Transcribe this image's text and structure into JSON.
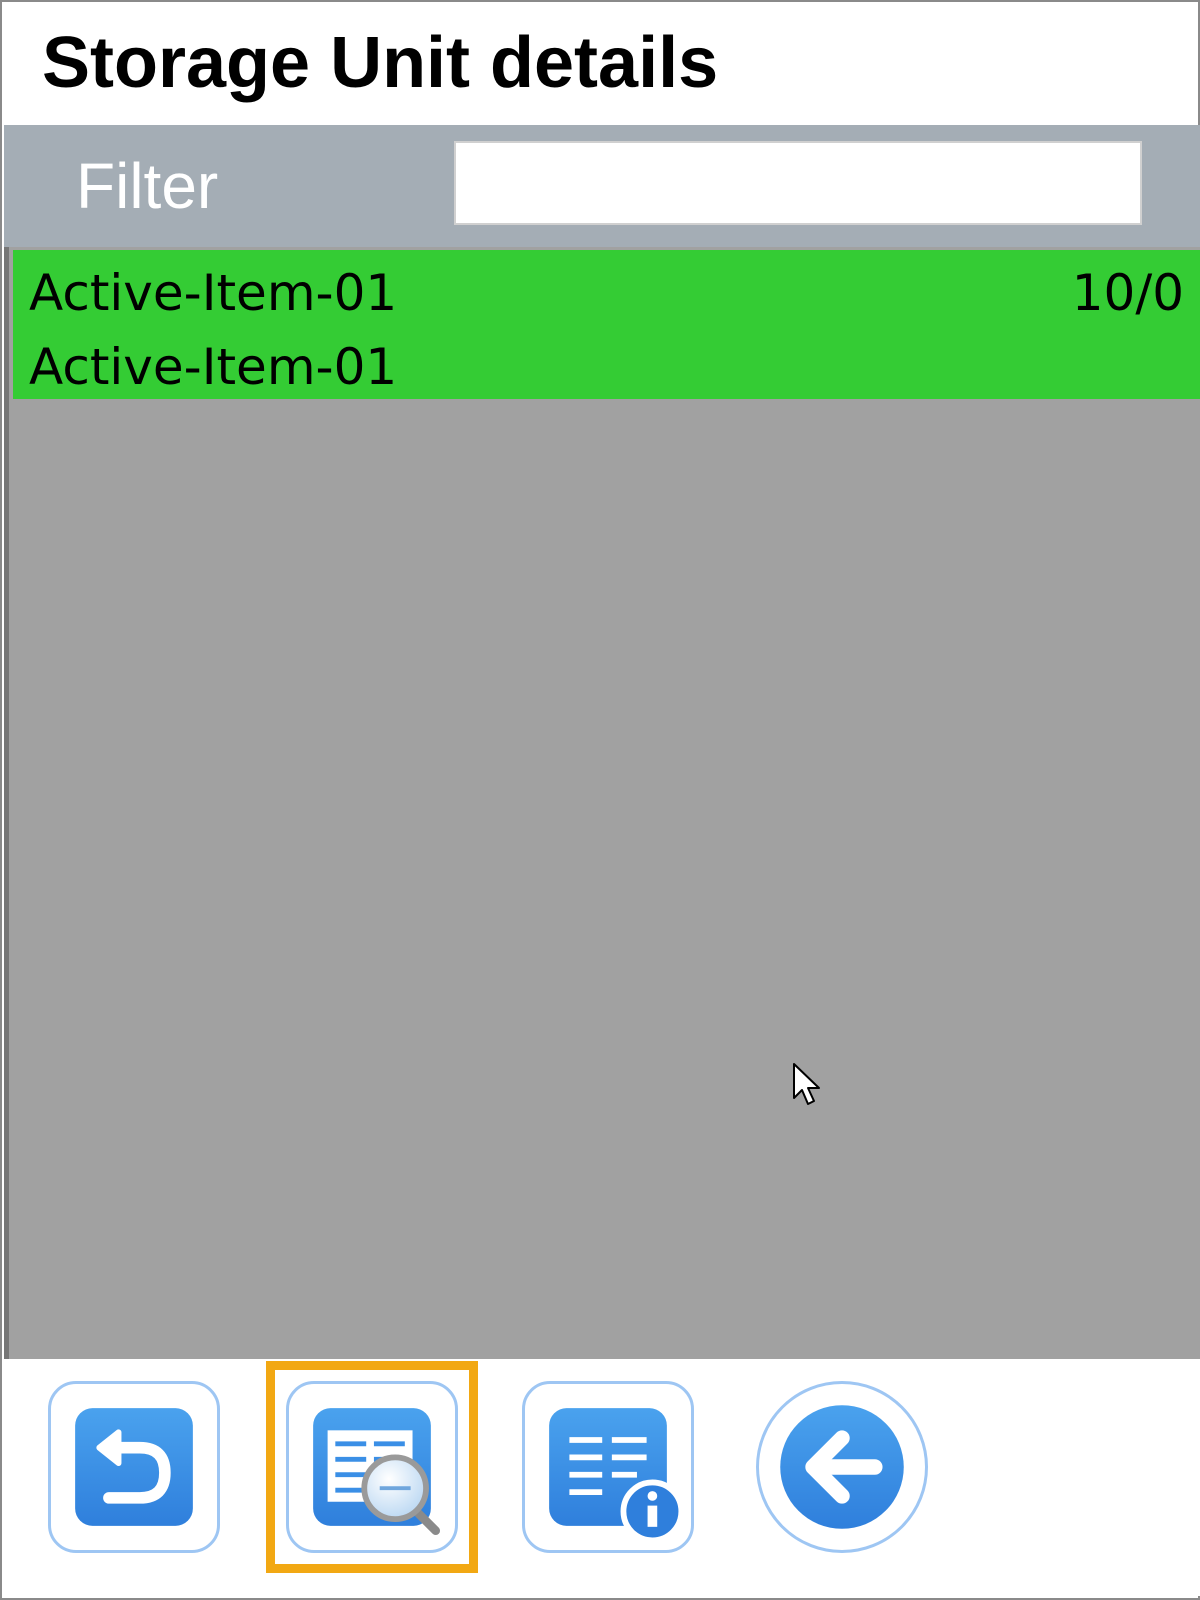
{
  "header": {
    "title": "Storage Unit details"
  },
  "filter": {
    "label": "Filter",
    "value": "",
    "placeholder": ""
  },
  "list": {
    "items": [
      {
        "line1": "Active-Item-01",
        "line2": "Active-Item-01",
        "quantity": "10/0",
        "selected": true
      }
    ]
  },
  "toolbar": {
    "buttons": [
      {
        "icon": "undo-icon"
      },
      {
        "icon": "view-details-icon",
        "highlighted": true
      },
      {
        "icon": "details-info-icon"
      },
      {
        "icon": "back-arrow-icon"
      }
    ]
  },
  "colors": {
    "selected_row": "#34cc34",
    "filter_bar": "#a4adb5",
    "list_background": "#a1a1a1",
    "button_blue": "#3a8fe6",
    "button_border": "#9ec6f3",
    "highlight": "#f2a813"
  }
}
